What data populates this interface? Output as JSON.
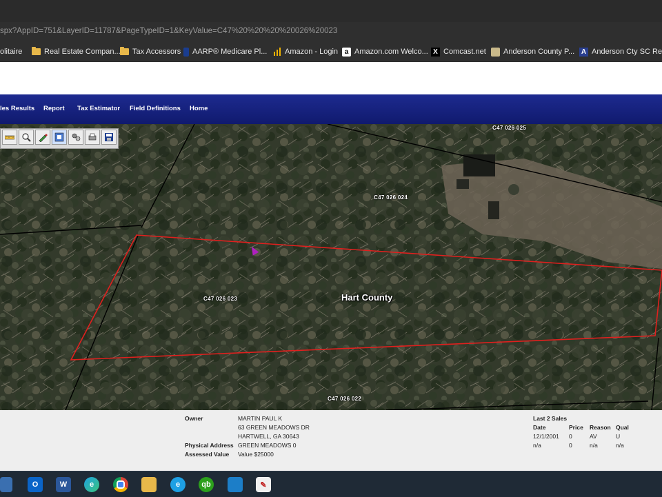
{
  "browser": {
    "url": "spx?AppID=751&LayerID=11787&PageTypeID=1&KeyValue=C47%20%20%20%20026%20023",
    "bookmarks": [
      {
        "label": "olitaire",
        "icon": "solitaire-icon"
      },
      {
        "label": "Real Estate Compan...",
        "icon": "folder-icon"
      },
      {
        "label": "Tax Accessors",
        "icon": "folder-icon"
      },
      {
        "label": "AARP® Medicare Pl...",
        "icon": "aarp-icon"
      },
      {
        "label": "Amazon - Login",
        "icon": "amazon-login-icon"
      },
      {
        "label": "Amazon.com Welco...",
        "icon": "amazon-icon"
      },
      {
        "label": "Comcast.net",
        "icon": "comcast-icon"
      },
      {
        "label": "Anderson County P...",
        "icon": "anderson-county-icon"
      },
      {
        "label": "Anderson Cty SC Re...",
        "icon": "anderson-cty-icon"
      }
    ]
  },
  "nav": {
    "items": [
      "les Results",
      "Report",
      "Tax Estimator",
      "Field Definitions",
      "Home"
    ]
  },
  "map": {
    "parcel_labels": [
      "C47    026 025",
      "C47    026 024",
      "C47    026 023",
      "C47    026 022"
    ],
    "county_label": "Hart County",
    "highlight_color": "#e0201e"
  },
  "info": {
    "owner_label": "Owner",
    "owner_name": "MARTIN PAUL K",
    "owner_address1": "63 GREEN MEADOWS DR",
    "owner_address2": "HARTWELL, GA 30643",
    "physical_address_label": "Physical Address",
    "physical_address": "GREEN MEADOWS 0",
    "assessed_value_label": "Assessed Value",
    "assessed_value": "Value $25000",
    "sales_title": "Last 2 Sales",
    "sales_headers": [
      "Date",
      "Price",
      "Reason",
      "Qual"
    ],
    "sales_rows": [
      [
        "12/1/2001",
        "0",
        "AV",
        "U"
      ],
      [
        "n/a",
        "0",
        "n/a",
        "n/a"
      ]
    ]
  },
  "taskbar": {
    "apps": [
      "outlook-icon",
      "word-icon",
      "edge-icon",
      "chrome-icon",
      "file-explorer-icon",
      "internet-explorer-icon",
      "quickbooks-icon",
      "remote-desktop-icon",
      "paint-icon"
    ]
  }
}
